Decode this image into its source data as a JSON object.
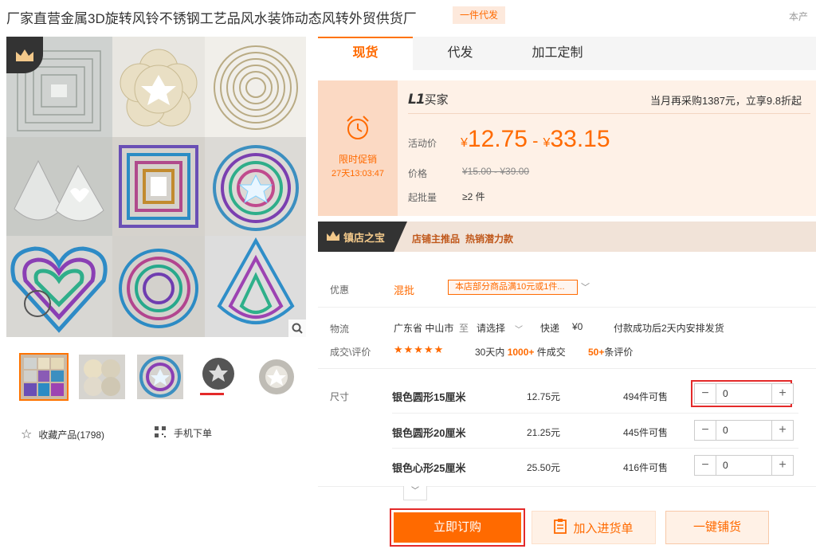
{
  "product": {
    "title": "厂家直营金属3D旋转风铃不锈钢工艺品风水装饰动态风转外贸供货厂",
    "dropship_badge": "一件代发",
    "right_note": "本产"
  },
  "gallery": {
    "favorite_label": "收藏产品(1798)",
    "mobile_label": "手机下单"
  },
  "tabs": [
    {
      "label": "现货"
    },
    {
      "label": "代发"
    },
    {
      "label": "加工定制"
    }
  ],
  "pricing": {
    "promo_label": "限时促销",
    "promo_timer": "27天13:03:47",
    "buyer_level_mark": "L1",
    "buyer_level_text": "买家",
    "tier_note": "当月再采购1387元，立享9.8折起",
    "activity_label": "活动价",
    "price_symbol": "¥",
    "price_low": "12.75",
    "price_sep": " - ",
    "price_high": "33.15",
    "orig_label": "价格",
    "orig_range": "¥15.00 - ¥39.00",
    "moq_label": "起批量",
    "moq_value": "≥2 件"
  },
  "banner": {
    "title": "镇店之宝",
    "tag1": "店铺主推品",
    "tag2": "热销潜力款"
  },
  "info": {
    "discount_label": "优惠",
    "mixed_label": "混批",
    "coupon_text": "本店部分商品满10元或1件...",
    "logistics_label": "物流",
    "origin": "广东省 中山市",
    "to": "至",
    "dest": "请选择",
    "express": "快递",
    "fee": "¥0",
    "ship_note": "付款成功后2天内安排发货",
    "reviews_label": "成交\\评价",
    "stars": "★★★★★",
    "deal_prefix": "30天内",
    "deal_count": "1000+",
    "deal_suffix": "件成交",
    "review_count": "50+",
    "review_suffix": "条评价"
  },
  "sizes": {
    "label": "尺寸",
    "rows": [
      {
        "name": "银色圆形15厘米",
        "price": "12.75元",
        "stock": "494件可售",
        "qty": "0"
      },
      {
        "name": "银色圆形20厘米",
        "price": "21.25元",
        "stock": "445件可售",
        "qty": "0"
      },
      {
        "name": "银色心形25厘米",
        "price": "25.50元",
        "stock": "416件可售",
        "qty": "0"
      }
    ],
    "minus": "−",
    "plus": "+"
  },
  "actions": {
    "order": "立即订购",
    "cart": "加入进货单",
    "distribute": "一键铺货"
  },
  "colors": {
    "accent": "#ff6a00",
    "highlight": "#e42a2a"
  }
}
